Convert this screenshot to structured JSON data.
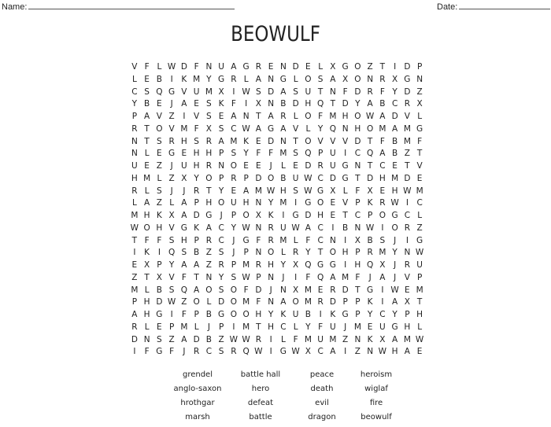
{
  "header": {
    "name_label": "Name:",
    "date_label": "Date:"
  },
  "title": "BEOWULF",
  "grid": [
    "VFLWDFNUAGRENDELXGOZTIDP",
    "LEBIKMYGRLANGLOSAXONRXGN",
    "CSQGVUMXIWSDASUTNFDRFYDZ",
    "YBEJAESKFIXNBDHQTDYABCRX",
    "PAVZIVSEANTARLOFMHOWADVL",
    "RTOVMFXSCWAGAVLYQNHOMAMG",
    "NTSRHSRAMKEDNTOVVVDTFBMF",
    "NLEGEHHPSYFFMSQPUICQABZT",
    "UEZJUHRNOEEJLEDRUGNTCETV",
    "HMLZXYOPRPDOBUWCDGTDHMDE",
    "RLSJJRTYEAMWHSWGXLFXEHWM",
    "LAZLAPHOUHNYMIGOEVPKRWIC",
    "MHKXADGJPOXKIGDHETCPOGCL",
    "WOHVGKACYWNRUWACIBNWIORZ",
    "TFFSHPRCJGFRMLFCNIXBSJIG",
    "IKIQSBZSJPNOLRYTOHPRMYNW",
    "EXPYAAZRPMRHYXQGGIHQXJRU",
    "ZTXVFTNYSWPNJIFQAMFJAJVP",
    "MLBSQAOSOFDJNXMERDTGIWEM",
    "PHDWZOLDOMFNAOMRDPPKIAXT",
    "AHGIFPBGOOHYKUBIKGPYCYPH",
    "RLEPMLJPIMTHCLYFUJMEUGHL",
    "DNSZADBZWWRILFMUMZNKXAMW",
    "IFGFJRCSRQWIGWXCAIZNWHAE"
  ],
  "words": [
    "grendel",
    "battle hall",
    "peace",
    "heroism",
    "anglo-saxon",
    "hero",
    "death",
    "wiglaf",
    "hrothgar",
    "defeat",
    "evil",
    "fire",
    "marsh",
    "battle",
    "dragon",
    "beowulf"
  ]
}
